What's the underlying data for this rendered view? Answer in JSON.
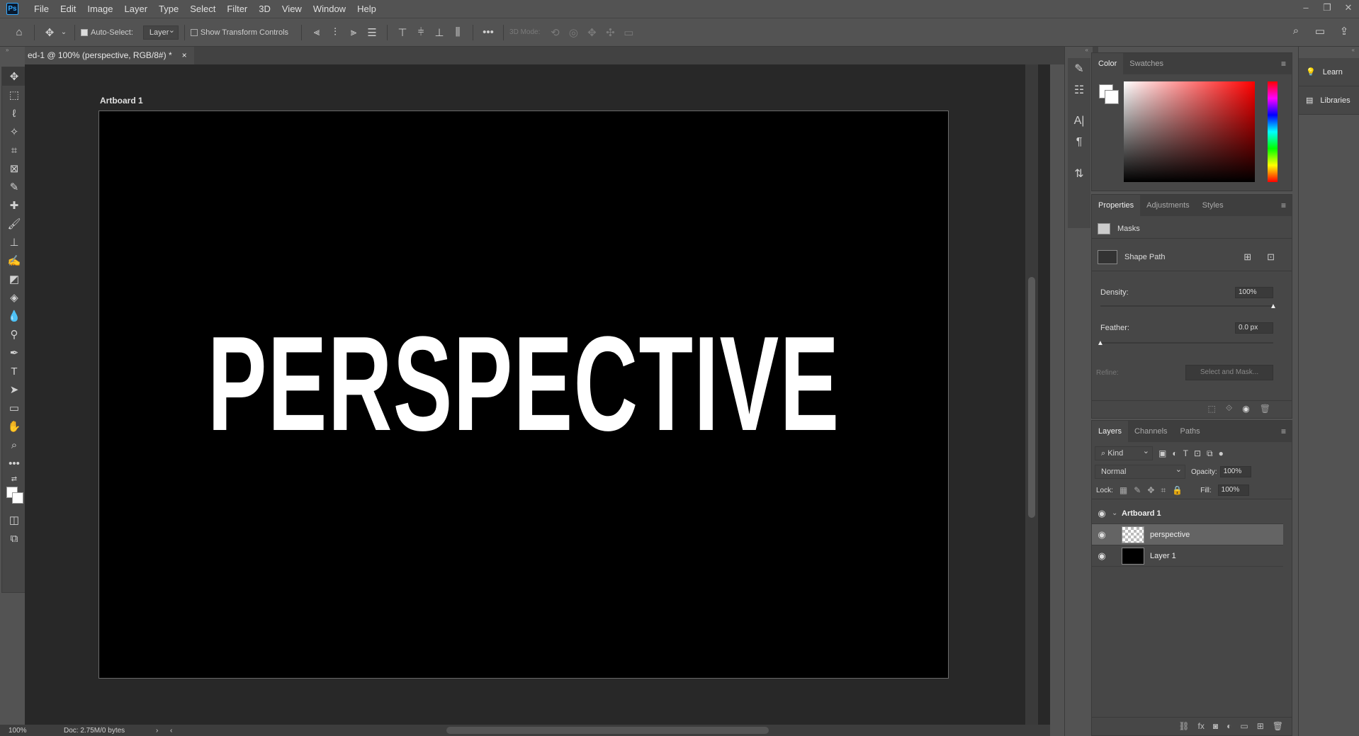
{
  "app": {
    "logo": "Ps"
  },
  "menu": [
    "File",
    "Edit",
    "Image",
    "Layer",
    "Type",
    "Select",
    "Filter",
    "3D",
    "View",
    "Window",
    "Help"
  ],
  "options": {
    "auto_select_label": "Auto-Select:",
    "auto_select_value": "Layer",
    "show_transform_label": "Show Transform Controls",
    "mode_3d_label": "3D Mode:"
  },
  "document": {
    "tab_title": "ed-1 @ 100% (perspective, RGB/8#) *",
    "tab_close": "×",
    "artboard_label": "Artboard 1",
    "canvas_text": "PERSPECTIVE"
  },
  "status": {
    "zoom": "100%",
    "doc": "Doc: 2.75M/0 bytes",
    "arrow": "›"
  },
  "color_panel": {
    "tabs": [
      "Color",
      "Swatches"
    ]
  },
  "properties_panel": {
    "tabs": [
      "Properties",
      "Adjustments",
      "Styles"
    ],
    "masks_label": "Masks",
    "shape_path_label": "Shape Path",
    "density_label": "Density:",
    "density_value": "100%",
    "density_level": 1.0,
    "feather_label": "Feather:",
    "feather_value": "0.0 px",
    "feather_level": 0.0,
    "refine_label": "Refine:",
    "select_mask_label": "Select and Mask..."
  },
  "layers_panel": {
    "tabs": [
      "Layers",
      "Channels",
      "Paths"
    ],
    "kind_label": "Kind",
    "blend_mode": "Normal",
    "opacity_label": "Opacity:",
    "opacity_value": "100%",
    "lock_label": "Lock:",
    "fill_label": "Fill:",
    "fill_value": "100%",
    "layers": [
      {
        "name": "Artboard 1",
        "type": "group"
      },
      {
        "name": "perspective",
        "type": "smart"
      },
      {
        "name": "Layer 1",
        "type": "fill"
      }
    ]
  },
  "right_panel": {
    "learn": "Learn",
    "libraries": "Libraries"
  },
  "colors": {
    "accent": "#31a8ff",
    "canvas_bg": "#282828",
    "artboard": "#000000",
    "text": "#ffffff"
  }
}
